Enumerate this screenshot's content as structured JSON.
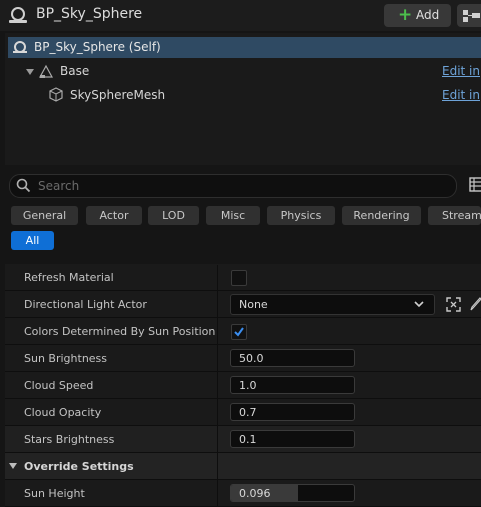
{
  "header": {
    "title": "BP_Sky_Sphere",
    "add_label": "Add"
  },
  "tree": {
    "self_label": "BP_Sky_Sphere (Self)",
    "items": [
      {
        "label": "Base",
        "link": "Edit in"
      },
      {
        "label": "SkySphereMesh",
        "link": "Edit in"
      }
    ]
  },
  "search": {
    "placeholder": "Search"
  },
  "tabs": [
    "General",
    "Actor",
    "LOD",
    "Misc",
    "Physics",
    "Rendering",
    "Stream",
    "All"
  ],
  "properties": {
    "refresh_material": {
      "label": "Refresh Material",
      "checked": false
    },
    "directional_light": {
      "label": "Directional Light Actor",
      "value": "None"
    },
    "colors_by_sun": {
      "label": "Colors Determined By Sun Position",
      "checked": true
    },
    "sun_brightness": {
      "label": "Sun Brightness",
      "value": "50.0"
    },
    "cloud_speed": {
      "label": "Cloud Speed",
      "value": "1.0"
    },
    "cloud_opacity": {
      "label": "Cloud Opacity",
      "value": "0.7"
    },
    "stars_brightness": {
      "label": "Stars Brightness",
      "value": "0.1"
    },
    "section_override": "Override Settings",
    "sun_height": {
      "label": "Sun Height",
      "value": "0.096"
    }
  },
  "colors": {
    "accent": "#0f6fd6",
    "selection": "#2f4a63",
    "link": "#6ea3d8"
  }
}
